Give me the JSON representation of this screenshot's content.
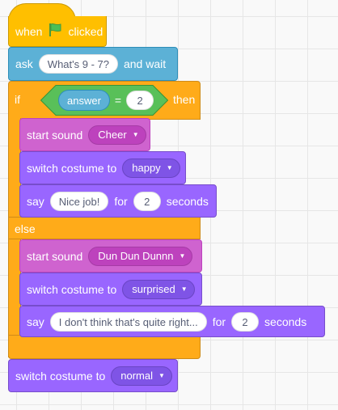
{
  "script": {
    "hat": {
      "when_label": "when",
      "flag_icon": "green-flag-icon",
      "clicked_label": "clicked"
    },
    "ask": {
      "label": "ask",
      "question": "What's 9 - 7?",
      "suffix": "and wait"
    },
    "if_else": {
      "if_label": "if",
      "then_label": "then",
      "else_label": "else",
      "condition": {
        "reporter": "answer",
        "operator": "=",
        "value": "2"
      },
      "then_branch": {
        "start_sound": {
          "label": "start sound",
          "sound": "Cheer"
        },
        "switch_costume": {
          "label": "switch costume to",
          "costume": "happy"
        },
        "say": {
          "label": "say",
          "message": "Nice job!",
          "for_label": "for",
          "seconds_value": "2",
          "seconds_label": "seconds"
        }
      },
      "else_branch": {
        "start_sound": {
          "label": "start sound",
          "sound": "Dun Dun Dunnn"
        },
        "switch_costume": {
          "label": "switch costume to",
          "costume": "surprised"
        },
        "say": {
          "label": "say",
          "message": "I don't think that's quite right...",
          "for_label": "for",
          "seconds_value": "2",
          "seconds_label": "seconds"
        }
      }
    },
    "final_switch_costume": {
      "label": "switch costume to",
      "costume": "normal"
    }
  },
  "colors": {
    "events": "#ffbf00",
    "control": "#ffab19",
    "sensing": "#5cb1d6",
    "operators": "#59c059",
    "sound": "#cf63cf",
    "looks": "#9966ff"
  }
}
